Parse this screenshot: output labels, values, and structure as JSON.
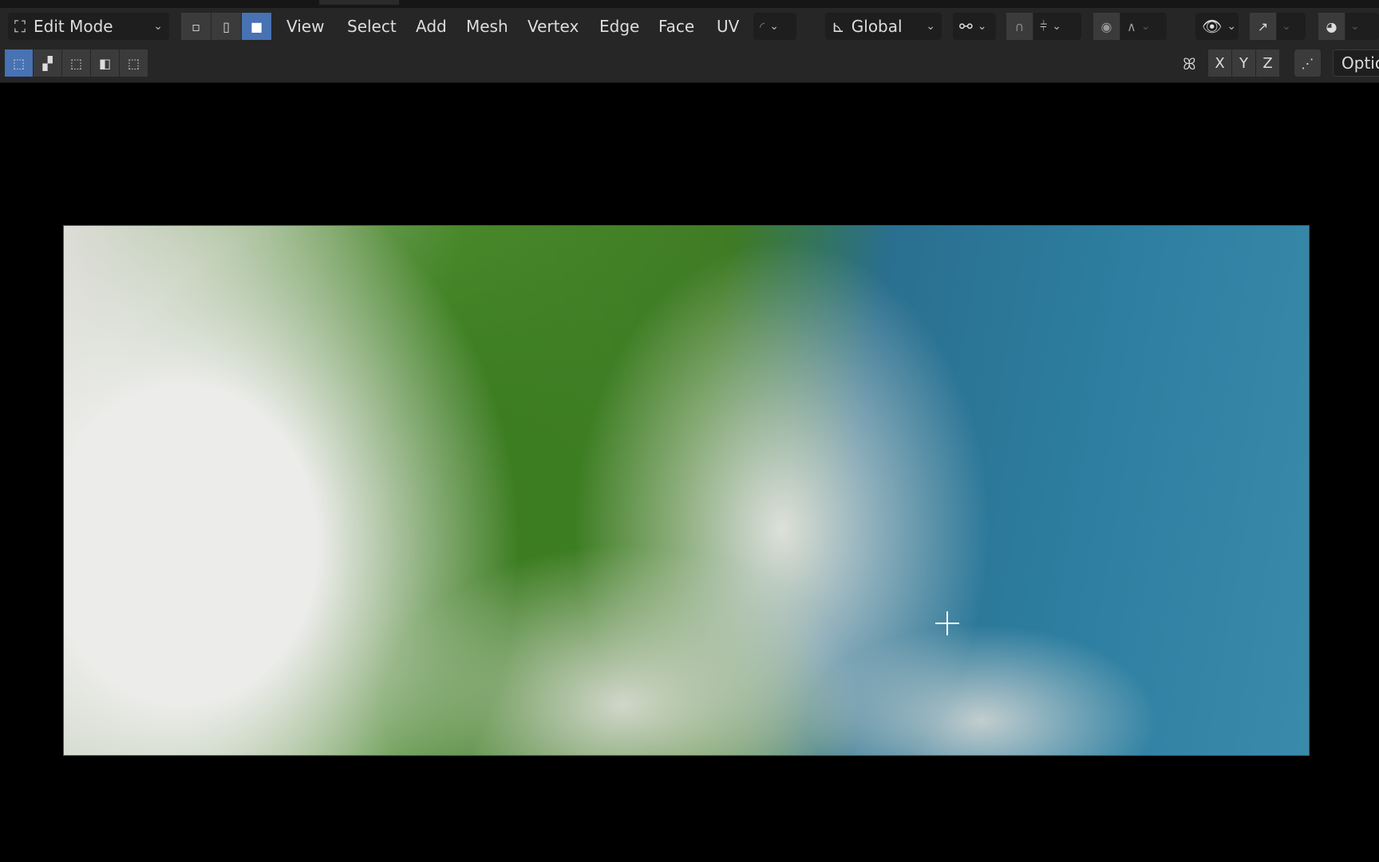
{
  "header": {
    "mode": "Edit Mode",
    "select_modes": [
      "vertex-select",
      "edge-select",
      "face-select"
    ],
    "active_select_mode": "face-select",
    "menus": [
      "View",
      "Select",
      "Add",
      "Mesh",
      "Vertex",
      "Edge",
      "Face",
      "UV"
    ],
    "transform_orientation": "Global",
    "accent_color": "#4772b3"
  },
  "toolbar2": {
    "select_box_modes": [
      "set",
      "extend",
      "subtract",
      "invert",
      "intersect"
    ],
    "mirror_axes": [
      "X",
      "Y",
      "Z"
    ],
    "options_label": "Optio"
  }
}
